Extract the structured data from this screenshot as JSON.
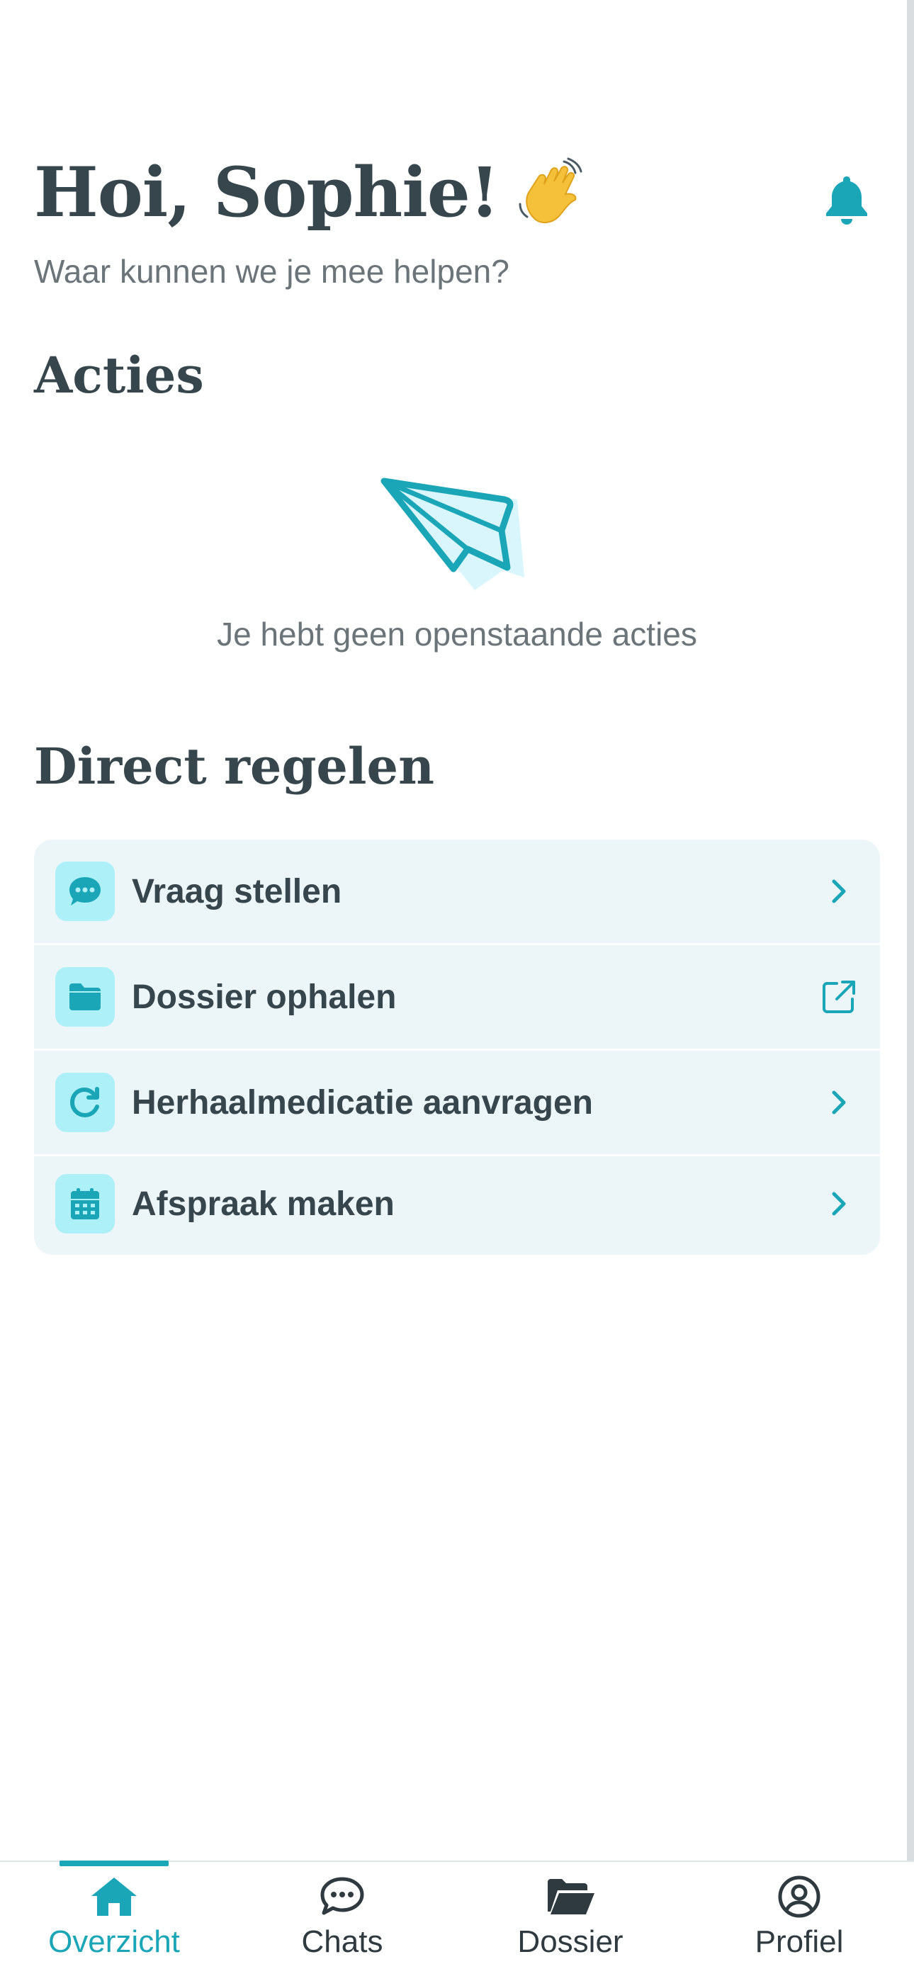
{
  "header": {
    "greeting": "Hoi, Sophie!",
    "subtitle": "Waar kunnen we je mee helpen?"
  },
  "acties": {
    "title": "Acties",
    "empty_text": "Je hebt geen openstaande acties"
  },
  "direct": {
    "title": "Direct regelen",
    "items": [
      {
        "label": "Vraag stellen",
        "icon": "chat-bubble-icon",
        "trail": "chevron-right-icon"
      },
      {
        "label": "Dossier ophalen",
        "icon": "folder-icon",
        "trail": "external-link-icon"
      },
      {
        "label": "Herhaalmedicatie aanvragen",
        "icon": "refresh-icon",
        "trail": "chevron-right-icon"
      },
      {
        "label": "Afspraak maken",
        "icon": "calendar-icon",
        "trail": "chevron-right-icon"
      }
    ]
  },
  "tabbar": {
    "tabs": [
      {
        "label": "Overzicht",
        "icon": "home-icon",
        "active": true
      },
      {
        "label": "Chats",
        "icon": "chat-icon",
        "active": false
      },
      {
        "label": "Dossier",
        "icon": "folder-open-icon",
        "active": false
      },
      {
        "label": "Profiel",
        "icon": "user-circle-icon",
        "active": false
      }
    ]
  },
  "colors": {
    "accent": "#1ba6b8",
    "text": "#37454d",
    "muted": "#6b7479",
    "card_bg": "#ecf5f8",
    "icon_bg": "#aef0f8"
  }
}
